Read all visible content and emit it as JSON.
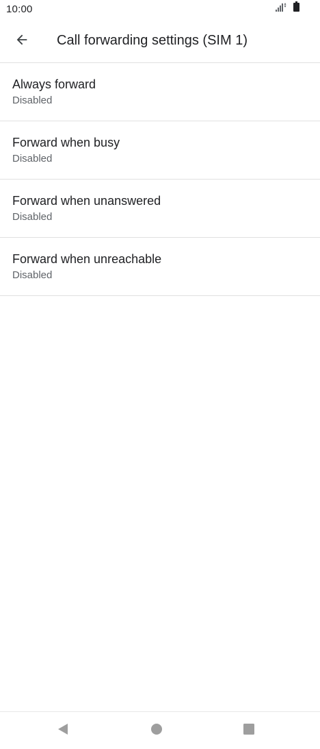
{
  "status_bar": {
    "time": "10:00",
    "icons": [
      "signal-icon",
      "battery-icon"
    ]
  },
  "app_bar": {
    "back_icon": "arrow-left-icon",
    "title": "Call forwarding settings (SIM 1)"
  },
  "settings": [
    {
      "title": "Always forward",
      "summary": "Disabled"
    },
    {
      "title": "Forward when busy",
      "summary": "Disabled"
    },
    {
      "title": "Forward when unanswered",
      "summary": "Disabled"
    },
    {
      "title": "Forward when unreachable",
      "summary": "Disabled"
    }
  ],
  "nav_bar": {
    "icons": [
      "back-triangle-icon",
      "home-circle-icon",
      "recents-square-icon"
    ]
  },
  "colors": {
    "text_primary": "#202124",
    "text_secondary": "#5f6368",
    "divider": "#e0e0e0",
    "nav_icon": "#9e9e9e"
  }
}
